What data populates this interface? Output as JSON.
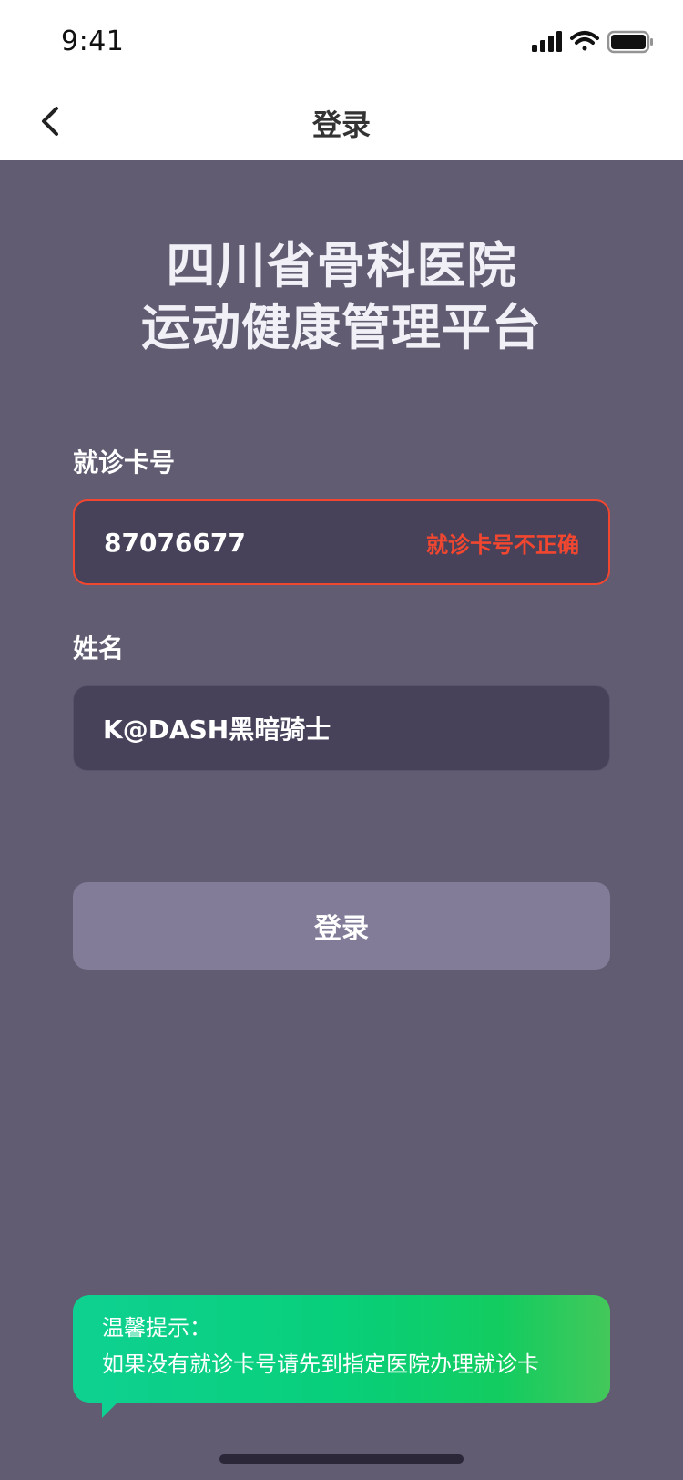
{
  "status_bar": {
    "time": "9:41",
    "icons": [
      "cellular-signal-icon",
      "wifi-icon",
      "battery-icon"
    ]
  },
  "nav": {
    "back_icon": "chevron-left-icon",
    "title": "登录"
  },
  "hero": {
    "line1": "四川省骨科医院",
    "line2": "运动健康管理平台"
  },
  "form": {
    "card_label": "就诊卡号",
    "card_value": "87076677",
    "card_error": "就诊卡号不正确",
    "name_label": "姓名",
    "name_value": "K@DASH黑暗骑士",
    "submit_label": "登录"
  },
  "tip": {
    "title": "温馨提示：",
    "body": "如果没有就诊卡号请先到指定医院办理就诊卡"
  },
  "colors": {
    "background": "#615c72",
    "field_bg": "#47415a",
    "error": "#f1462f",
    "button_bg": "#827c98",
    "tip_green": "#08cf7a"
  }
}
